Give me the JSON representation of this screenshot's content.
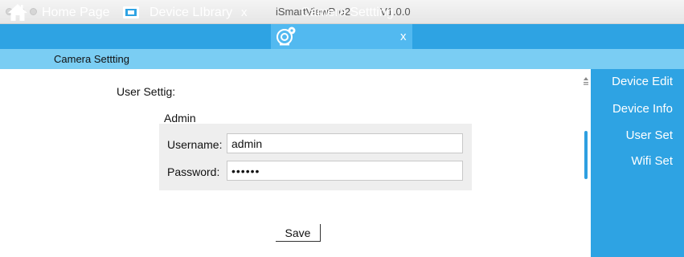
{
  "window": {
    "title": "iSmartViewPro2",
    "version": "V1.0.0"
  },
  "tabs": {
    "home": {
      "label": "Home Page",
      "icon": "home-icon"
    },
    "library": {
      "label": "Device LIbrary",
      "close": "x",
      "icon": "device-library-icon"
    },
    "camera": {
      "label": "Camera Settting",
      "close": "x",
      "icon": "camera-settings-icon",
      "active": true
    }
  },
  "subbar": {
    "label": "Camera Settting"
  },
  "user_settings": {
    "title": "User Settig:",
    "group_label": "Admin",
    "username_label": "Username:",
    "username_value": "admin",
    "password_label": "Password:",
    "password_value": "123456"
  },
  "actions": {
    "save_label": "Save"
  },
  "side_menu": {
    "items": [
      {
        "label": "Device Edit"
      },
      {
        "label": "Device Info"
      },
      {
        "label": "User Set"
      },
      {
        "label": "Wifi Set"
      }
    ]
  },
  "colors": {
    "accent": "#2ea3e3",
    "active_tab": "#52b9f0",
    "subbar": "#7acdf3",
    "form_panel": "#eeeeee"
  }
}
